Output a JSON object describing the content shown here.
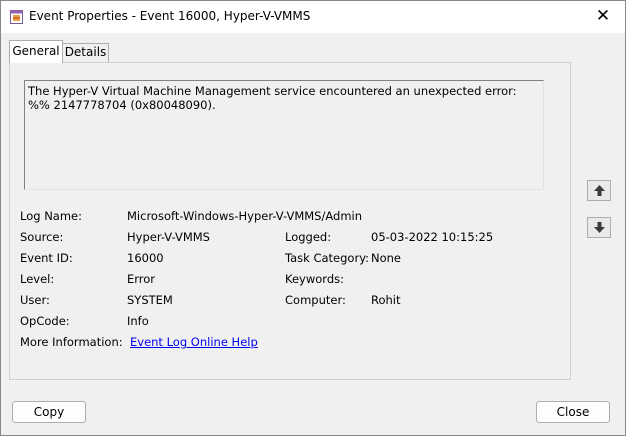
{
  "window": {
    "title": "Event Properties - Event 16000, Hyper-V-VMMS",
    "close_glyph": "✕"
  },
  "tabs": [
    {
      "label": "General",
      "selected": true
    },
    {
      "label": "Details",
      "selected": false
    }
  ],
  "general": {
    "description": "The Hyper-V Virtual Machine Management service encountered an unexpected error: %% 2147778704 (0x80048090).",
    "fields": {
      "log_name": {
        "label": "Log Name:",
        "value": "Microsoft-Windows-Hyper-V-VMMS/Admin"
      },
      "source": {
        "label": "Source:",
        "value": "Hyper-V-VMMS"
      },
      "logged": {
        "label": "Logged:",
        "value": "05-03-2022 10:15:25"
      },
      "event_id": {
        "label": "Event ID:",
        "value": "16000"
      },
      "task_category": {
        "label": "Task Category:",
        "value": "None"
      },
      "level": {
        "label": "Level:",
        "value": "Error"
      },
      "keywords": {
        "label": "Keywords:",
        "value": ""
      },
      "user": {
        "label": "User:",
        "value": "SYSTEM"
      },
      "computer": {
        "label": "Computer:",
        "value": "Rohit"
      },
      "opcode": {
        "label": "OpCode:",
        "value": "Info"
      },
      "more_info": {
        "label": "More Information:",
        "link": "Event Log Online Help"
      }
    }
  },
  "nav_icons": {
    "up": "arrow-up-icon",
    "down": "arrow-down-icon"
  },
  "buttons": {
    "copy": "Copy",
    "close": "Close"
  },
  "colors": {
    "link": "#0000ee",
    "background": "#f0f0f0"
  }
}
